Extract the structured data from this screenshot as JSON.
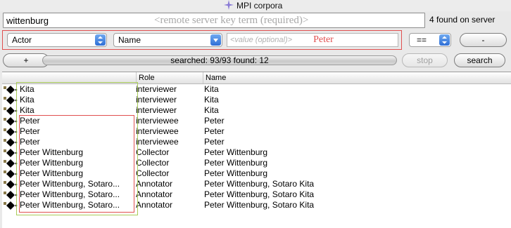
{
  "window": {
    "title": "MPI corpora"
  },
  "search": {
    "value": "wittenburg",
    "hint": "<remote server key term (required)>",
    "found_on_server": "4 found on server"
  },
  "filter": {
    "field_select": "Actor",
    "attribute_select": "Name",
    "value_placeholder": "<value (optional)>",
    "value_annotation": "Peter",
    "operator_select": "==",
    "remove_label": "-"
  },
  "controls": {
    "add_label": "+",
    "status": "searched: 93/93 found: 12",
    "progress": 1.0,
    "stop_label": "stop",
    "search_label": "search"
  },
  "table": {
    "columns": [
      "",
      "Role",
      "Name"
    ],
    "rows": [
      {
        "item": "Kita",
        "role": "interviewer",
        "name": "Kita"
      },
      {
        "item": "Kita",
        "role": "interviewer",
        "name": "Kita"
      },
      {
        "item": "Kita",
        "role": "interviewer",
        "name": "Kita"
      },
      {
        "item": "Peter",
        "role": "interviewee",
        "name": "Peter"
      },
      {
        "item": "Peter",
        "role": "interviewee",
        "name": "Peter"
      },
      {
        "item": "Peter",
        "role": "interviewee",
        "name": "Peter"
      },
      {
        "item": "Peter Wittenburg",
        "role": "Collector",
        "name": "Peter Wittenburg"
      },
      {
        "item": "Peter Wittenburg",
        "role": "Collector",
        "name": "Peter Wittenburg"
      },
      {
        "item": "Peter Wittenburg",
        "role": "Collector",
        "name": "Peter Wittenburg"
      },
      {
        "item": "Peter Wittenburg, Sotaro...",
        "role": "Annotator",
        "name": "Peter Wittenburg, Sotaro Kita"
      },
      {
        "item": "Peter Wittenburg, Sotaro...",
        "role": "Annotator",
        "name": "Peter Wittenburg, Sotaro Kita"
      },
      {
        "item": "Peter Wittenburg, Sotaro...",
        "role": "Annotator",
        "name": "Peter Wittenburg, Sotaro Kita"
      }
    ]
  },
  "icons": {
    "title_icon": "sparkle-icon",
    "row_icon": "session-node-icon",
    "select_arrow": "up-down-arrows-icon"
  },
  "colors": {
    "annotation_red": "#e05050",
    "annotation_green": "#a9cc5a",
    "select_blue": "#2f6fd6"
  }
}
